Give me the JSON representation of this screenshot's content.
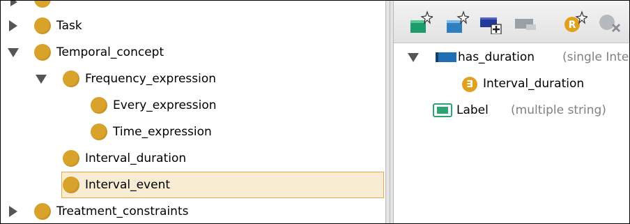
{
  "class_tree": {
    "items": [
      {
        "label": "Task",
        "expanded": false
      },
      {
        "label": "Temporal_concept",
        "expanded": true
      },
      {
        "label": "Frequency_expression",
        "expanded": true
      },
      {
        "label": "Every_expression"
      },
      {
        "label": "Time_expression"
      },
      {
        "label": "Interval_duration"
      },
      {
        "label": "Interval_event",
        "selected": true
      },
      {
        "label": "Treatment_constraints",
        "expanded": false
      }
    ]
  },
  "toolbar": {
    "icons": [
      "create-class-icon",
      "create-subclass-icon",
      "add-property-icon",
      "remove-property-icon",
      "restriction-icon",
      "delete-icon"
    ]
  },
  "properties": {
    "items": [
      {
        "name": "has_duration",
        "detail": "(single Inte",
        "expanded": true
      },
      {
        "name": "Interval_duration",
        "restriction": true
      },
      {
        "name": "Label",
        "detail": "(multiple string)"
      }
    ]
  },
  "colors": {
    "class_dot": "#d9a22a",
    "selection_bg": "#f8ecd2",
    "selection_border": "#e7a84d",
    "object_property": "#1f6fb2",
    "datatype_property": "#2aa674",
    "icon_green": "#1d9b6a",
    "icon_blue": "#2e7fc1",
    "icon_navy": "#24379b",
    "icon_orange": "#e2a01f"
  }
}
